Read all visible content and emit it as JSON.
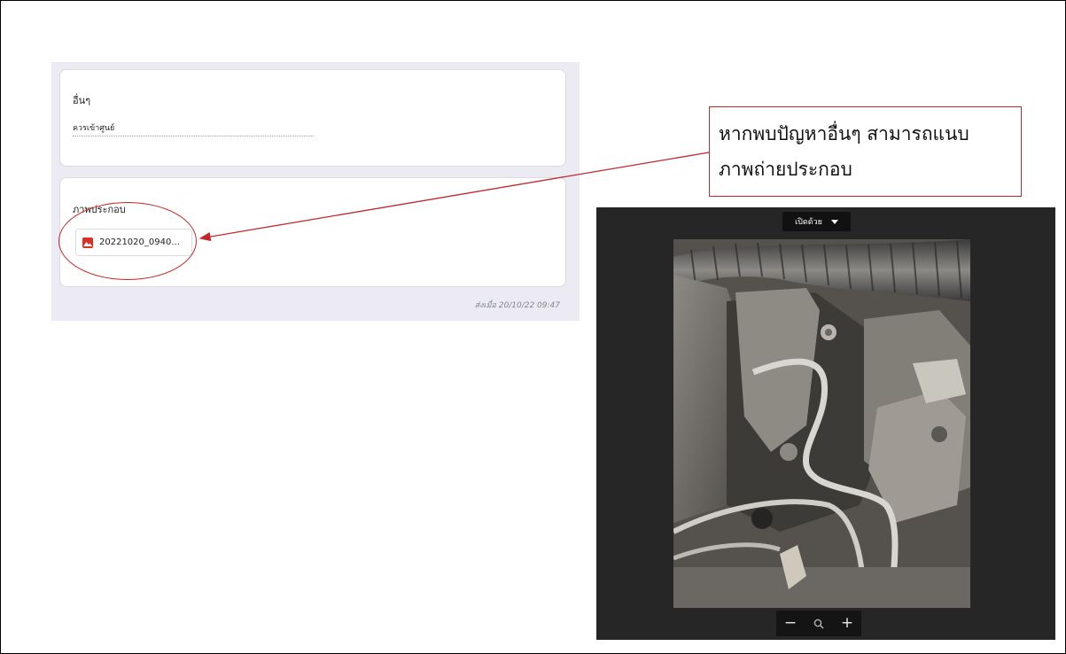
{
  "form": {
    "other_card": {
      "title": "อื่นๆ",
      "answer": "ควรเข้าศูนย์"
    },
    "image_card": {
      "title": "ภาพประกอบ",
      "file_name": "20221020_0940...",
      "file_icon": "image-file-icon"
    },
    "submitted_text": "ส่งเมื่อ 20/10/22 09:47"
  },
  "callout": {
    "line1": "หากพบปัญหาอื่นๆ สามารถแนบ",
    "line2": "ภาพถ่ายประกอบ"
  },
  "viewer": {
    "open_with_label": "เปิดด้วย",
    "zoom_out": "−",
    "zoom_icon": "magnifier-icon",
    "zoom_in": "+"
  },
  "colors": {
    "annotation_red": "#c0282a",
    "form_background": "#ecebf4",
    "viewer_background": "#262626"
  }
}
